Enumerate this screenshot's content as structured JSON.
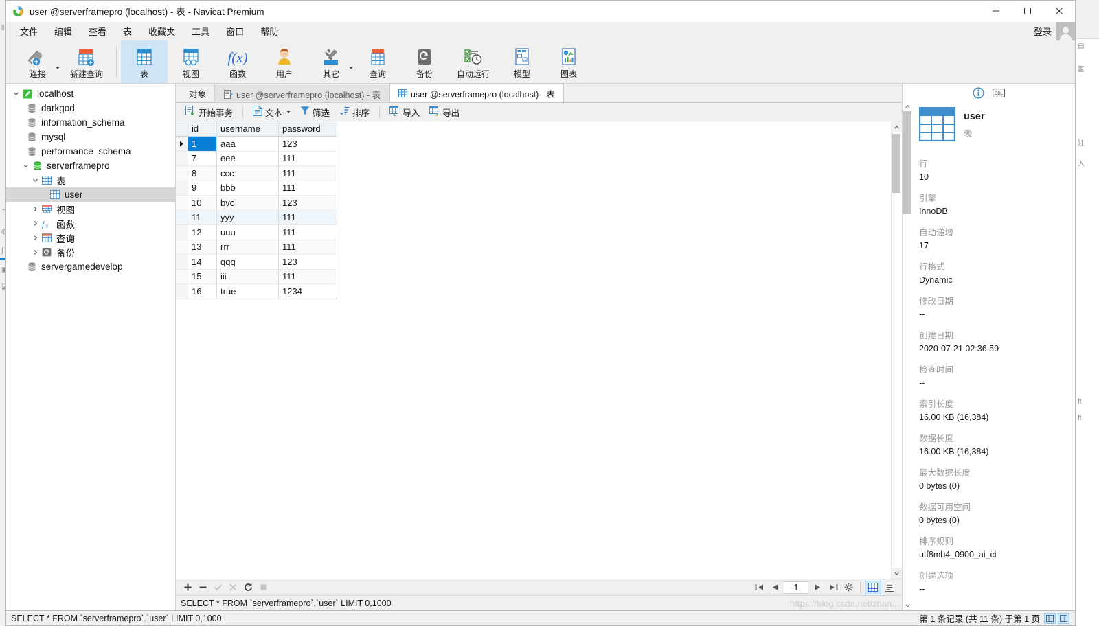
{
  "window": {
    "title": "user @serverframepro (localhost) - 表 - Navicat Premium",
    "logo_icon": "navicat-logo-icon",
    "minimize_icon": "minimize-icon",
    "maximize_icon": "maximize-icon",
    "close_icon": "close-icon"
  },
  "menubar": {
    "items": [
      {
        "label": "文件",
        "name": "menu-file"
      },
      {
        "label": "编辑",
        "name": "menu-edit"
      },
      {
        "label": "查看",
        "name": "menu-view"
      },
      {
        "label": "表",
        "name": "menu-table"
      },
      {
        "label": "收藏夹",
        "name": "menu-favorites"
      },
      {
        "label": "工具",
        "name": "menu-tools"
      },
      {
        "label": "窗口",
        "name": "menu-window"
      },
      {
        "label": "帮助",
        "name": "menu-help"
      }
    ],
    "login_label": "登录",
    "avatar_icon": "user-avatar-icon"
  },
  "toolbar": {
    "items": [
      {
        "label": "连接",
        "icon": "connection-icon",
        "has_caret": true,
        "active": false
      },
      {
        "label": "新建查询",
        "icon": "new-query-icon",
        "has_caret": false,
        "active": false
      },
      {
        "label": "表",
        "icon": "table-icon",
        "has_caret": false,
        "active": true
      },
      {
        "label": "视图",
        "icon": "view-icon",
        "has_caret": false,
        "active": false
      },
      {
        "label": "函数",
        "icon": "function-icon",
        "has_caret": false,
        "active": false
      },
      {
        "label": "用户",
        "icon": "user-icon",
        "has_caret": false,
        "active": false
      },
      {
        "label": "其它",
        "icon": "others-icon",
        "has_caret": true,
        "active": false
      },
      {
        "label": "查询",
        "icon": "query-icon",
        "has_caret": false,
        "active": false
      },
      {
        "label": "备份",
        "icon": "backup-icon",
        "has_caret": false,
        "active": false
      },
      {
        "label": "自动运行",
        "icon": "automation-icon",
        "has_caret": false,
        "active": false
      },
      {
        "label": "模型",
        "icon": "model-icon",
        "has_caret": false,
        "active": false
      },
      {
        "label": "图表",
        "icon": "chart-icon",
        "has_caret": false,
        "active": false
      }
    ]
  },
  "sidebar": {
    "items": [
      {
        "label": "localhost",
        "indent": 0,
        "twisty": "down",
        "icon": "mysql-connection-icon",
        "selected": false
      },
      {
        "label": "darkgod",
        "indent": 1,
        "twisty": "none",
        "icon": "database-icon",
        "selected": false
      },
      {
        "label": "information_schema",
        "indent": 1,
        "twisty": "none",
        "icon": "database-icon",
        "selected": false
      },
      {
        "label": "mysql",
        "indent": 1,
        "twisty": "none",
        "icon": "database-icon",
        "selected": false
      },
      {
        "label": "performance_schema",
        "indent": 1,
        "twisty": "none",
        "icon": "database-icon",
        "selected": false
      },
      {
        "label": "serverframepro",
        "indent": 1,
        "twisty": "down",
        "icon": "database-open-icon",
        "selected": false
      },
      {
        "label": "表",
        "indent": 2,
        "twisty": "down",
        "icon": "tables-folder-icon",
        "selected": false
      },
      {
        "label": "user",
        "indent": 3,
        "twisty": "none",
        "icon": "table-small-icon",
        "selected": true
      },
      {
        "label": "视图",
        "indent": 2,
        "twisty": "right",
        "icon": "views-folder-icon",
        "selected": false
      },
      {
        "label": "函数",
        "indent": 2,
        "twisty": "right",
        "icon": "functions-folder-icon",
        "selected": false
      },
      {
        "label": "查询",
        "indent": 2,
        "twisty": "right",
        "icon": "queries-folder-icon",
        "selected": false
      },
      {
        "label": "备份",
        "indent": 2,
        "twisty": "right",
        "icon": "backups-folder-icon",
        "selected": false
      },
      {
        "label": "servergamedevelop",
        "indent": 1,
        "twisty": "none",
        "icon": "database-icon",
        "selected": false
      }
    ]
  },
  "tabs": [
    {
      "label": "对象",
      "icon": "objects-icon",
      "active": false,
      "kind": "objects"
    },
    {
      "label": "user @serverframepro (localhost) - 表",
      "icon": "table-design-icon",
      "active": false,
      "kind": "design"
    },
    {
      "label": "user @serverframepro (localhost) - 表",
      "icon": "table-data-icon",
      "active": true,
      "kind": "data"
    }
  ],
  "gridbar": {
    "items": [
      {
        "label": "开始事务",
        "icon": "begin-transaction-icon",
        "caret": false
      },
      {
        "label": "文本",
        "icon": "text-icon",
        "caret": true
      },
      {
        "label": "筛选",
        "icon": "filter-icon",
        "caret": false
      },
      {
        "label": "排序",
        "icon": "sort-icon",
        "caret": false
      },
      {
        "label": "导入",
        "icon": "import-icon",
        "caret": false
      },
      {
        "label": "导出",
        "icon": "export-icon",
        "caret": false
      }
    ]
  },
  "grid": {
    "columns": [
      "id",
      "username",
      "password"
    ],
    "rows": [
      {
        "id": "1",
        "username": "aaa",
        "password": "123"
      },
      {
        "id": "7",
        "username": "eee",
        "password": "111"
      },
      {
        "id": "8",
        "username": "ccc",
        "password": "111"
      },
      {
        "id": "9",
        "username": "bbb",
        "password": "111"
      },
      {
        "id": "10",
        "username": "bvc",
        "password": "123"
      },
      {
        "id": "11",
        "username": "yyy",
        "password": "111"
      },
      {
        "id": "12",
        "username": "uuu",
        "password": "111"
      },
      {
        "id": "13",
        "username": "rrr",
        "password": "111"
      },
      {
        "id": "14",
        "username": "qqq",
        "password": "123"
      },
      {
        "id": "15",
        "username": "iii",
        "password": "111"
      },
      {
        "id": "16",
        "username": "true",
        "password": "1234"
      }
    ],
    "selected_row_index": 0,
    "tinted_row_index": 5
  },
  "record_nav": {
    "add_icon": "add-record-icon",
    "remove_icon": "remove-record-icon",
    "confirm_icon": "confirm-edit-icon",
    "cancel_icon": "cancel-edit-icon",
    "refresh_icon": "refresh-icon",
    "stop_icon": "stop-icon",
    "first_icon": "first-page-icon",
    "prev_icon": "prev-page-icon",
    "page_value": "1",
    "next_icon": "next-page-icon",
    "last_icon": "last-page-icon",
    "settings_icon": "gear-icon",
    "grid_view_icon": "grid-view-icon",
    "form_view_icon": "form-view-icon"
  },
  "sql_preview": "SELECT * FROM `serverframepro`.`user` LIMIT 0,1000",
  "info_panel": {
    "info_tab_icon": "info-icon",
    "ddl_tab_icon": "ddl-icon",
    "object_icon": "table-large-icon",
    "object_name": "user",
    "object_kind": "表",
    "properties": [
      {
        "key": "行",
        "value": "10"
      },
      {
        "key": "引擎",
        "value": "InnoDB"
      },
      {
        "key": "自动递增",
        "value": "17"
      },
      {
        "key": "行格式",
        "value": "Dynamic"
      },
      {
        "key": "修改日期",
        "value": "--"
      },
      {
        "key": "创建日期",
        "value": "2020-07-21 02:36:59"
      },
      {
        "key": "检查时间",
        "value": "--"
      },
      {
        "key": "索引长度",
        "value": "16.00 KB (16,384)"
      },
      {
        "key": "数据长度",
        "value": "16.00 KB (16,384)"
      },
      {
        "key": "最大数据长度",
        "value": "0 bytes (0)"
      },
      {
        "key": "数据可用空间",
        "value": "0 bytes (0)"
      },
      {
        "key": "排序规则",
        "value": "utf8mb4_0900_ai_ci"
      },
      {
        "key": "创建选项",
        "value": "--"
      }
    ]
  },
  "statusbar": {
    "sql": "SELECT * FROM `serverframepro`.`user` LIMIT 0,1000",
    "record_text": "第 1 条记录 (共 11 条) 于第 1 页",
    "icon_a": "split-view-icon",
    "icon_b": "detail-view-icon"
  },
  "watermark": "https://blog.csdn.net/zhan...",
  "colors": {
    "accent": "#0a7fd6",
    "toolbar_bg": "#f0f0f0",
    "active_tab_bg": "#cde5f7",
    "selection_bg": "#d6d6d6",
    "header_bg": "#eef3f8"
  }
}
